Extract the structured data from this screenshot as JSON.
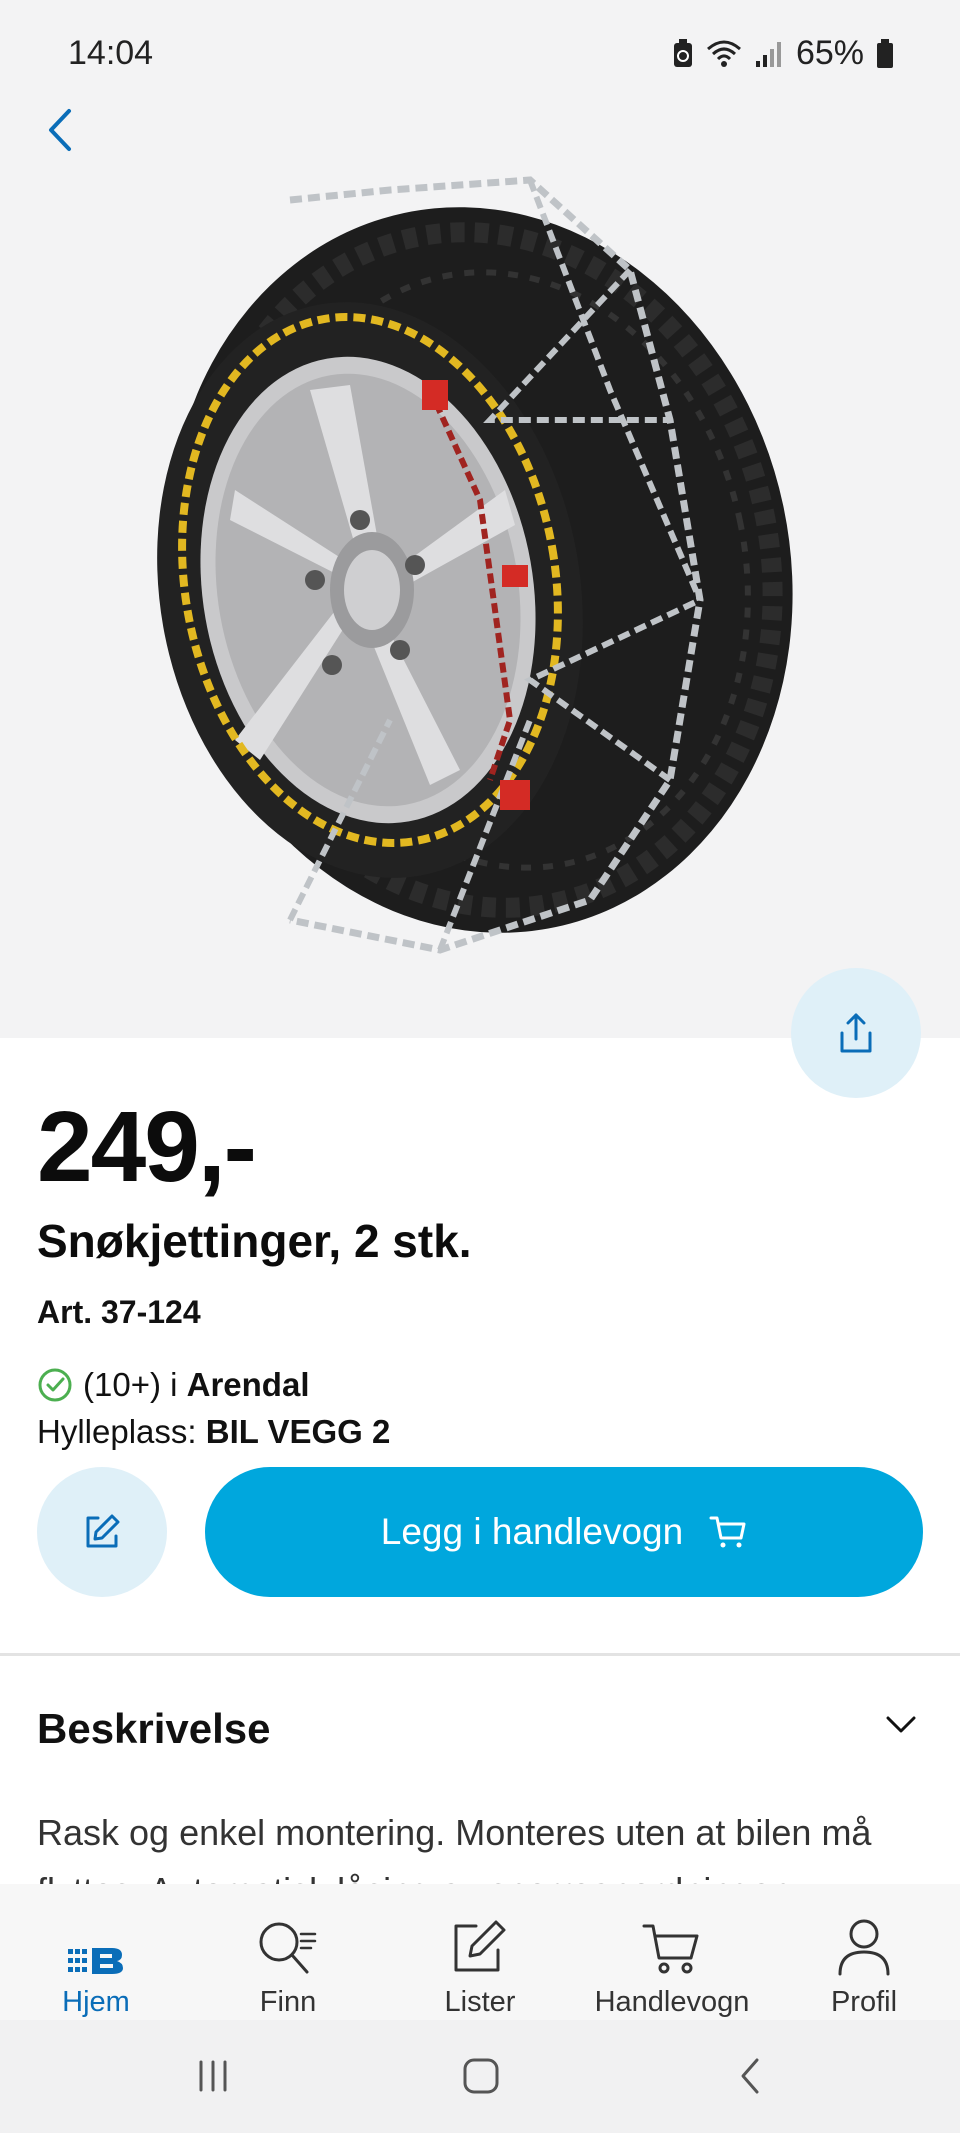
{
  "status_bar": {
    "time": "14:04",
    "battery": "65%"
  },
  "product": {
    "price": "249,-",
    "title": "Snøkjettinger, 2 stk.",
    "article": "Art. 37-124",
    "stock_count": "(10+) i ",
    "stock_store": "Arendal",
    "shelf_label": "Hylleplass: ",
    "shelf_value": "BIL VEGG 2",
    "image_icon": "tire-with-snow-chains-image"
  },
  "actions": {
    "add_to_cart_label": "Legg i handlevogn"
  },
  "description": {
    "heading": "Beskrivelse",
    "text": "Rask og enkel montering. Monteres uten at bilen må flyttes. Automatisk låsing av sperreanordningen"
  },
  "bottom_nav": {
    "items": [
      {
        "label": "Hjem",
        "icon": "home-logo-icon",
        "active": true
      },
      {
        "label": "Finn",
        "icon": "search-list-icon"
      },
      {
        "label": "Lister",
        "icon": "edit-list-icon"
      },
      {
        "label": "Handlevogn",
        "icon": "cart-icon"
      },
      {
        "label": "Profil",
        "icon": "profile-icon"
      }
    ]
  },
  "colors": {
    "accent": "#00a7dd",
    "link": "#0a6db8",
    "light_accent": "#dff0f8",
    "check": "#4caf50"
  }
}
